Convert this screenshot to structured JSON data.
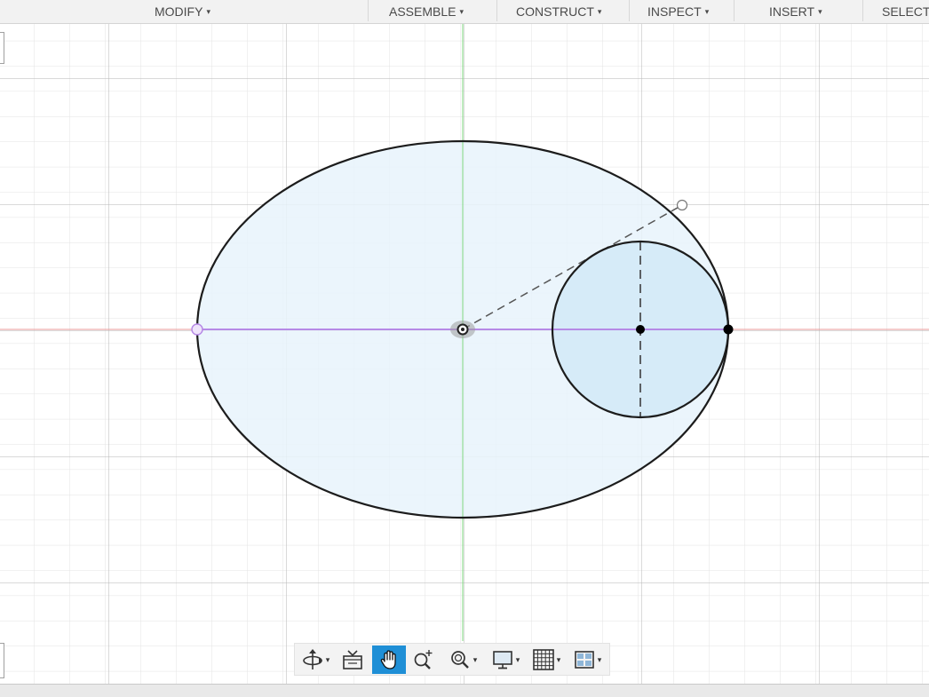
{
  "toolbar": {
    "menus": [
      {
        "label": "MODIFY"
      },
      {
        "label": "ASSEMBLE"
      },
      {
        "label": "CONSTRUCT"
      },
      {
        "label": "INSPECT"
      },
      {
        "label": "INSERT"
      },
      {
        "label": "SELECT"
      }
    ],
    "caret": "▾"
  },
  "sketch": {
    "colors": {
      "profile_fill": "#e7f3fc",
      "profile_fill_overlap": "#d4eaf7",
      "sketch_line": "#1c1c1c",
      "construction_line": "#555555",
      "x_axis": "#e89a9a",
      "y_axis": "#7fd87f",
      "selected_line": "#b68ae6",
      "grid_minor": "#e3e3e3",
      "grid_major": "#b5b5b5"
    },
    "entities": [
      "outer-ellipse",
      "inner-circle",
      "major-axis-line",
      "radius-construction-line",
      "vertical-diameter-line",
      "origin-point",
      "center-point",
      "tangent-point",
      "handle-point"
    ]
  },
  "nav_bar": {
    "buttons": [
      {
        "name": "orbit-icon",
        "has_caret": true
      },
      {
        "name": "look-at-icon",
        "has_caret": false
      },
      {
        "name": "pan-icon",
        "has_caret": false,
        "active": true
      },
      {
        "name": "zoom-icon",
        "has_caret": false
      },
      {
        "name": "fit-icon",
        "has_caret": true
      },
      {
        "name": "display-settings-icon",
        "has_caret": true
      },
      {
        "name": "grid-snaps-icon",
        "has_caret": true
      },
      {
        "name": "viewports-icon",
        "has_caret": true
      }
    ],
    "active_color": "#1f8fd6"
  }
}
